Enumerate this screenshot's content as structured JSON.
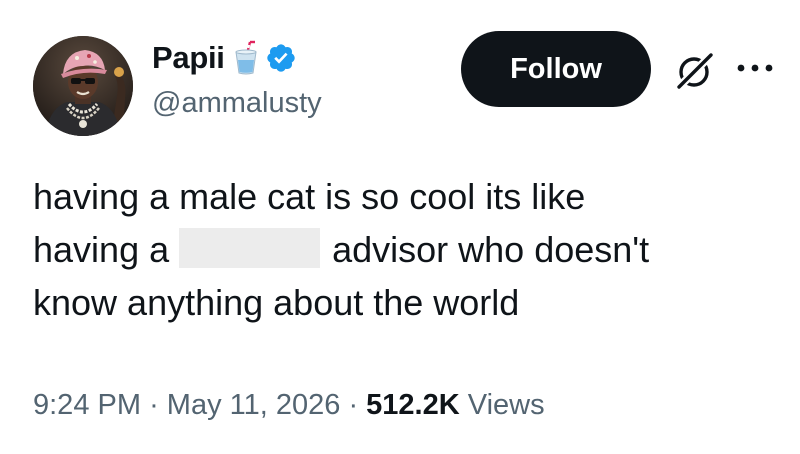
{
  "author": {
    "display_name": "Papii",
    "handle": "@ammalusty",
    "name_emoji": "cup-with-straw-icon",
    "verified": true,
    "verified_color": "#1d9bf0"
  },
  "actions": {
    "follow_label": "Follow",
    "grok_icon": "grok-icon",
    "more_icon": "more-options-icon"
  },
  "tweet": {
    "line1": "having a male cat is so cool its like",
    "line2_before": "having a",
    "line2_after": "advisor who doesn't",
    "line3": "know anything about the world"
  },
  "meta": {
    "time": "9:24 PM",
    "separator": "·",
    "date": "May 11, 2026",
    "views_count": "512.2K",
    "views_label": "Views"
  },
  "colors": {
    "text_primary": "#0f1419",
    "text_secondary": "#536471",
    "button_bg": "#0f1419",
    "button_text": "#ffffff",
    "redaction": "#ececec"
  }
}
